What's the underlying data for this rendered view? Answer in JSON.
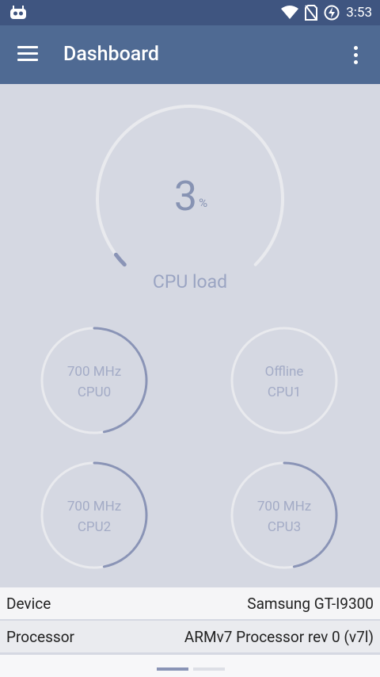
{
  "status_bar": {
    "time": "3:53",
    "icons": [
      "notification-bot-icon",
      "wifi-icon",
      "no-sim-icon",
      "battery-charging-icon"
    ]
  },
  "app_bar": {
    "title": "Dashboard",
    "icons": [
      "menu-icon",
      "overflow-menu-icon"
    ]
  },
  "cpu_load": {
    "value": "3",
    "unit": "%",
    "label": "CPU load",
    "fraction": 0.03
  },
  "cores": [
    {
      "freq": "700 MHz",
      "name": "CPU0",
      "fraction": 0.47
    },
    {
      "freq": "Offline",
      "name": "CPU1",
      "fraction": 0
    },
    {
      "freq": "700 MHz",
      "name": "CPU2",
      "fraction": 0.47
    },
    {
      "freq": "700 MHz",
      "name": "CPU3",
      "fraction": 0.47
    }
  ],
  "info": {
    "device_label": "Device",
    "device_value": "Samsung GT-I9300",
    "processor_label": "Processor",
    "processor_value": "ARMv7 Processor rev 0 (v7l)"
  },
  "pager": {
    "pages": 2,
    "active": 0
  },
  "colors": {
    "status_bar": "#3f5580",
    "app_bar": "#4f6a93",
    "background": "#d5d8e2",
    "gauge_track": "#e9eaee",
    "gauge_fill": "#8a94b6"
  }
}
